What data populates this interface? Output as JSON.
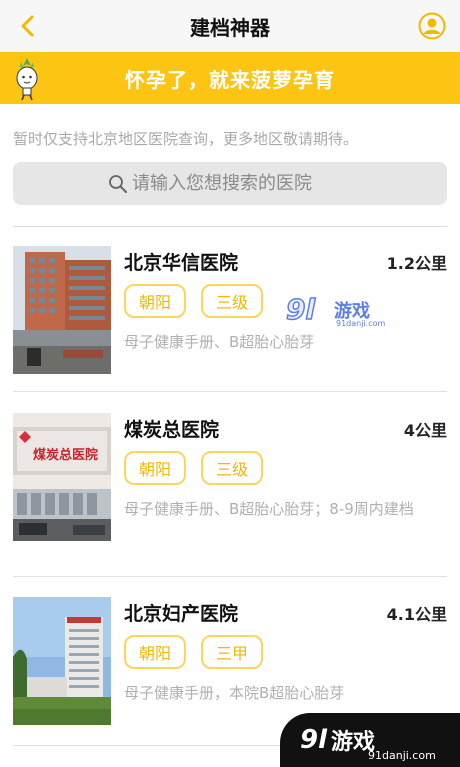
{
  "header": {
    "title": "建档神器",
    "back_icon": "chevron-left-icon",
    "user_icon": "user-icon",
    "accent": "#fcc514"
  },
  "banner": {
    "text": "怀孕了，就来菠萝孕育",
    "mascot_icon": "pineapple-mascot-icon"
  },
  "notice": "暂时仅支持北京地区医院查询，更多地区敬请期待。",
  "search": {
    "placeholder": "请输入您想搜索的医院"
  },
  "hospitals": [
    {
      "name": "北京华信医院",
      "distance": "1.2公里",
      "tags": [
        "朝阳",
        "三级"
      ],
      "services": "母子健康手册、B超胎心胎芽"
    },
    {
      "name": "煤炭总医院",
      "distance": "4公里",
      "tags": [
        "朝阳",
        "三级"
      ],
      "services": "母子健康手册、B超胎心胎芽；8-9周内建档",
      "photo_sign": "煤炭总医院"
    },
    {
      "name": "北京妇产医院",
      "distance": "4.1公里",
      "tags": [
        "朝阳",
        "三甲"
      ],
      "services": "母子健康手册，本院B超胎心胎芽"
    }
  ],
  "watermark": {
    "logo": "9l",
    "title": "游戏",
    "url": "91danji.com"
  }
}
